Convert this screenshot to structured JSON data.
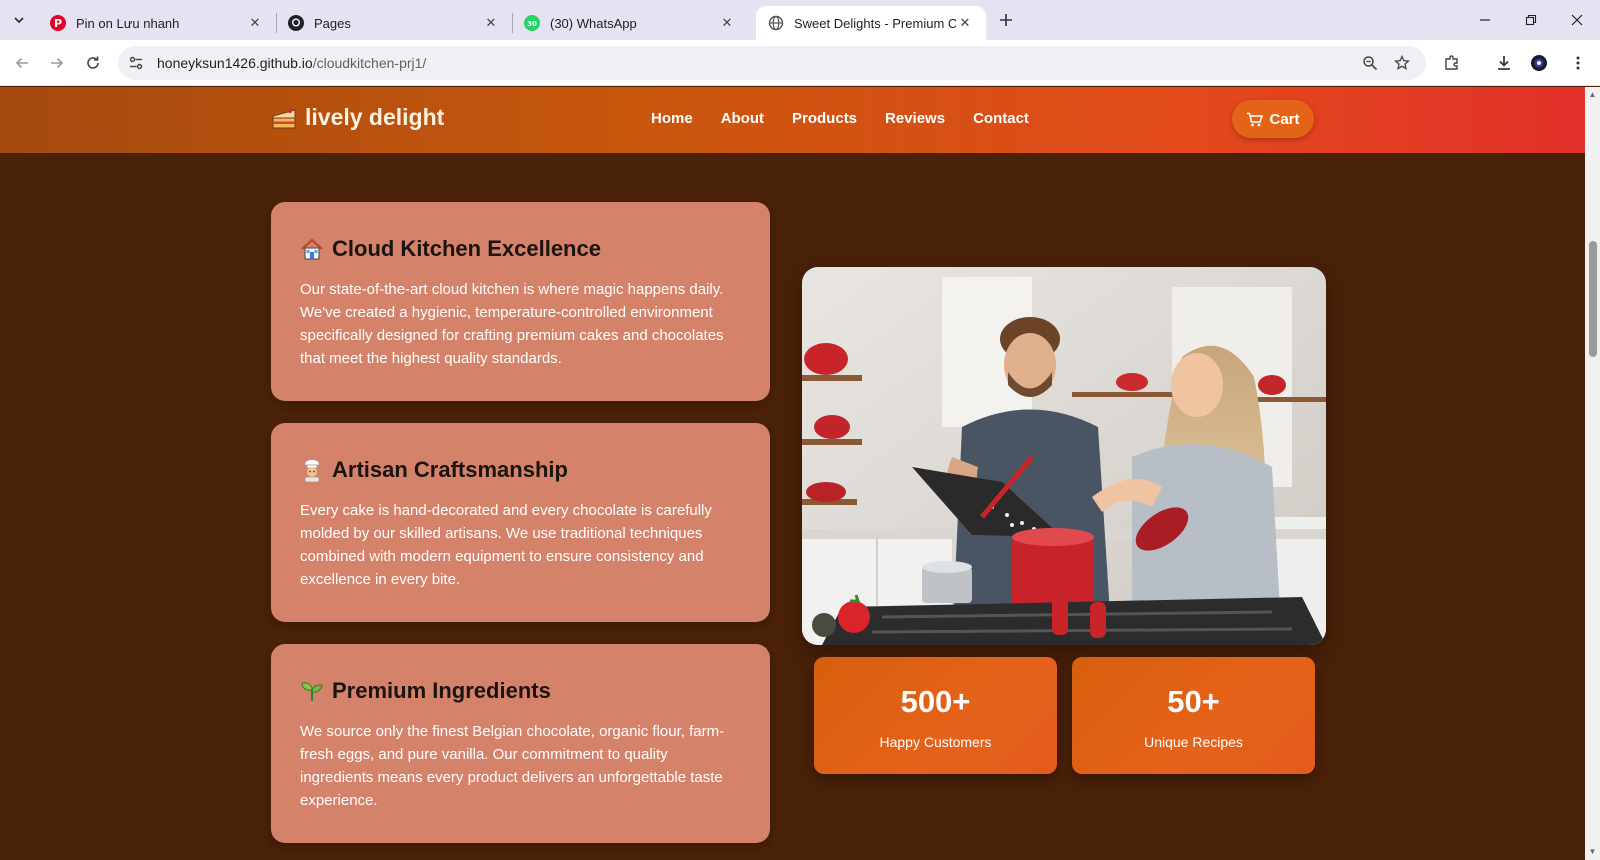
{
  "browser": {
    "tabs": [
      {
        "title": "Pin on Lưu nhanh",
        "icon": "pinterest-icon",
        "active": false
      },
      {
        "title": "Pages",
        "icon": "github-icon",
        "active": false
      },
      {
        "title": "(30) WhatsApp",
        "icon": "whatsapp-icon",
        "badge": "30",
        "active": false
      },
      {
        "title": "Sweet Delights - Premium Cakes",
        "icon": "globe-icon",
        "active": true
      }
    ],
    "url_host": "honeyksun1426.github.io",
    "url_path": "/cloudkitchen-prj1/"
  },
  "header": {
    "logo_text": "lively delight",
    "nav": [
      "Home",
      "About",
      "Products",
      "Reviews",
      "Contact"
    ],
    "cart_label": "Cart"
  },
  "features": [
    {
      "icon": "house-icon",
      "title": "Cloud Kitchen Excellence",
      "text": "Our state-of-the-art cloud kitchen is where magic happens daily. We've created a hygienic, temperature-controlled environment specifically designed for crafting premium cakes and chocolates that meet the highest quality standards."
    },
    {
      "icon": "chef-icon",
      "title": "Artisan Craftsmanship",
      "text": "Every cake is hand-decorated and every chocolate is carefully molded by our skilled artisans. We use traditional techniques combined with modern equipment to ensure consistency and excellence in every bite."
    },
    {
      "icon": "seedling-icon",
      "title": "Premium Ingredients",
      "text": "We source only the finest Belgian chocolate, organic flour, farm-fresh eggs, and pure vanilla. Our commitment to quality ingredients means every product delivers an unforgettable taste experience."
    }
  ],
  "stats": [
    {
      "value": "500+",
      "label": "Happy Customers"
    },
    {
      "value": "50+",
      "label": "Unique Recipes"
    }
  ],
  "colors": {
    "page_bg": "#4a2109",
    "card_bg": "#d4826a",
    "accent": "#e36418"
  }
}
